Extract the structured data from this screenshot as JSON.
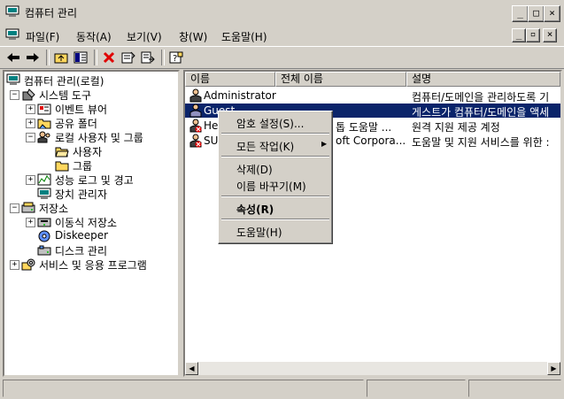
{
  "window": {
    "title": "컴퓨터 관리",
    "min_btn": "_",
    "max_btn": "□",
    "close_btn": "×"
  },
  "menubar": {
    "items": [
      "파일(F)",
      "동작(A)",
      "보기(V)",
      "창(W)",
      "도움말(H)"
    ],
    "child_controls": [
      "_",
      "▫",
      "×"
    ]
  },
  "tree": {
    "root": "컴퓨터 관리(로컬)",
    "nodes": [
      "시스템 도구",
      "이벤트 뷰어",
      "공유 폴더",
      "로컬 사용자 및 그룹",
      "사용자",
      "그룹",
      "성능 로그 및 경고",
      "장치 관리자",
      "저장소",
      "이동식 저장소",
      "Diskeeper",
      "디스크 관리",
      "서비스 및 응용 프로그램"
    ]
  },
  "list": {
    "columns": [
      "이름",
      "전체 이름",
      "설명"
    ],
    "rows": [
      {
        "name": "Administrator",
        "full": "",
        "desc": "컴퓨터/도메인을 관리하도록 기"
      },
      {
        "name": "Guest",
        "full": "",
        "desc": "게스트가 컴퓨터/도메인을 액세"
      },
      {
        "name": "Hel",
        "full": "톱 도움말 ...",
        "desc": "원격 지원 제공 계정"
      },
      {
        "name": "SUI",
        "full": "oft Corpora...",
        "desc": "도움말 및 지원 서비스를 위한 :"
      }
    ]
  },
  "context_menu": {
    "set_password": "암호 설정(S)...",
    "all_tasks": "모든 작업(K)",
    "delete": "삭제(D)",
    "rename": "이름 바꾸기(M)",
    "properties": "속성(R)",
    "help": "도움말(H)"
  },
  "colors": {
    "selection": "#0a246a",
    "chrome": "#d4d0c8"
  }
}
